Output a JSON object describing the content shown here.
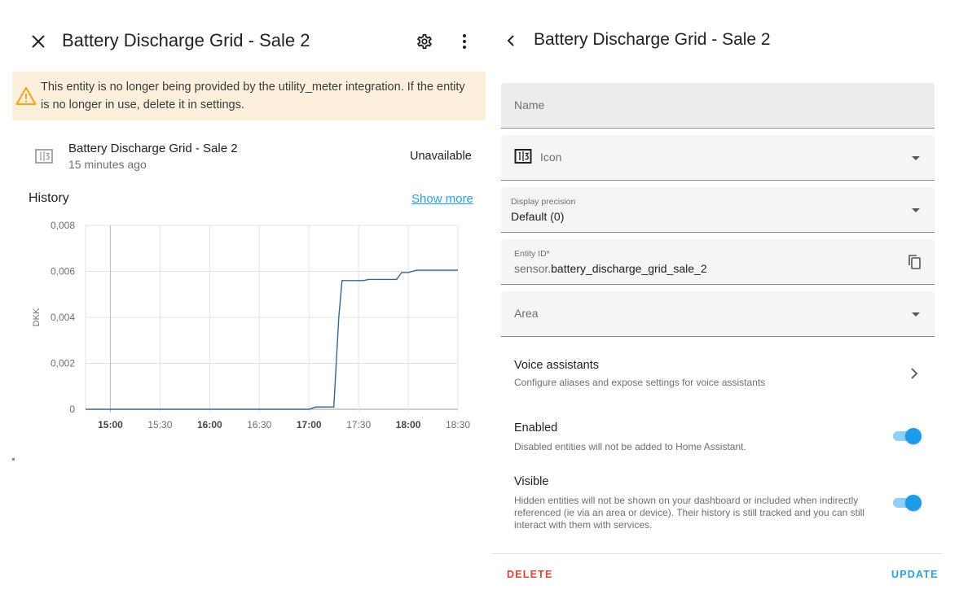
{
  "left_dialog": {
    "title": "Battery Discharge Grid - Sale 2",
    "icons": {
      "close": "close-icon",
      "settings": "gear-icon",
      "menu": "dots-vertical-icon"
    },
    "warning": {
      "icon": "alert-triangle-icon",
      "text": "This entity is no longer being provided by the utility_meter integration. If the entity is no longer in use, delete it in settings.",
      "color": "#f5a623",
      "background": "#fcefdc"
    },
    "entity": {
      "icon": "counter-icon",
      "name": "Battery Discharge Grid - Sale 2",
      "last_changed": "15 minutes ago",
      "state": "Unavailable"
    },
    "history": {
      "title": "History",
      "show_more": "Show more"
    }
  },
  "chart_data": {
    "type": "line",
    "ylabel": "DKK",
    "xlabel": "",
    "ylim": [
      0,
      0.008
    ],
    "y_ticks": [
      "0",
      "0,002",
      "0,004",
      "0,006",
      "0,008"
    ],
    "y_tick_values": [
      0,
      0.002,
      0.004,
      0.006,
      0.008
    ],
    "x_ticks": [
      {
        "label": "15:00",
        "bold": true,
        "minutes": 900
      },
      {
        "label": "15:30",
        "bold": false,
        "minutes": 930
      },
      {
        "label": "16:00",
        "bold": true,
        "minutes": 960
      },
      {
        "label": "16:30",
        "bold": false,
        "minutes": 990
      },
      {
        "label": "17:00",
        "bold": true,
        "minutes": 1020
      },
      {
        "label": "17:30",
        "bold": false,
        "minutes": 1050
      },
      {
        "label": "18:00",
        "bold": true,
        "minutes": 1080
      },
      {
        "label": "18:30",
        "bold": false,
        "minutes": 1110
      }
    ],
    "x_range_minutes": [
      885,
      1110
    ],
    "grid": true,
    "line_color": "#3b6587",
    "series": [
      {
        "x_minutes": [
          885,
          1020,
          1024,
          1035,
          1038,
          1040,
          1048,
          1053,
          1056,
          1059,
          1073,
          1076,
          1080,
          1085,
          1110
        ],
        "values": [
          0,
          0,
          0.0001,
          0.0001,
          0.004,
          0.0056,
          0.0056,
          0.0056,
          0.00565,
          0.00565,
          0.00565,
          0.00595,
          0.00595,
          0.00605,
          0.00605
        ]
      }
    ]
  },
  "right_dialog": {
    "title": "Battery Discharge Grid - Sale 2",
    "back_icon": "chevron-left-icon",
    "fields": {
      "name_label": "Name",
      "icon_label": "Icon",
      "icon_preview": "counter-icon",
      "precision_label": "Display precision",
      "precision_value": "Default (0)",
      "entity_id_label": "Entity ID*",
      "entity_id_prefix": "sensor.",
      "entity_id_value": "battery_discharge_grid_sale_2",
      "copy_icon": "copy-icon",
      "area_label": "Area"
    },
    "voice": {
      "title": "Voice assistants",
      "desc": "Configure aliases and expose settings for voice assistants"
    },
    "enabled": {
      "title": "Enabled",
      "desc": "Disabled entities will not be added to Home Assistant.",
      "on": true
    },
    "visible": {
      "title": "Visible",
      "desc": "Hidden entities will not be shown on your dashboard or included when indirectly referenced (ie via an area or device). Their history is still tracked and you can still interact with them with services.",
      "on": true
    },
    "delete_label": "DELETE",
    "update_label": "UPDATE",
    "colors": {
      "delete": "#db4437",
      "update": "#2e9fe0",
      "toggle": "#1e9be8"
    }
  }
}
